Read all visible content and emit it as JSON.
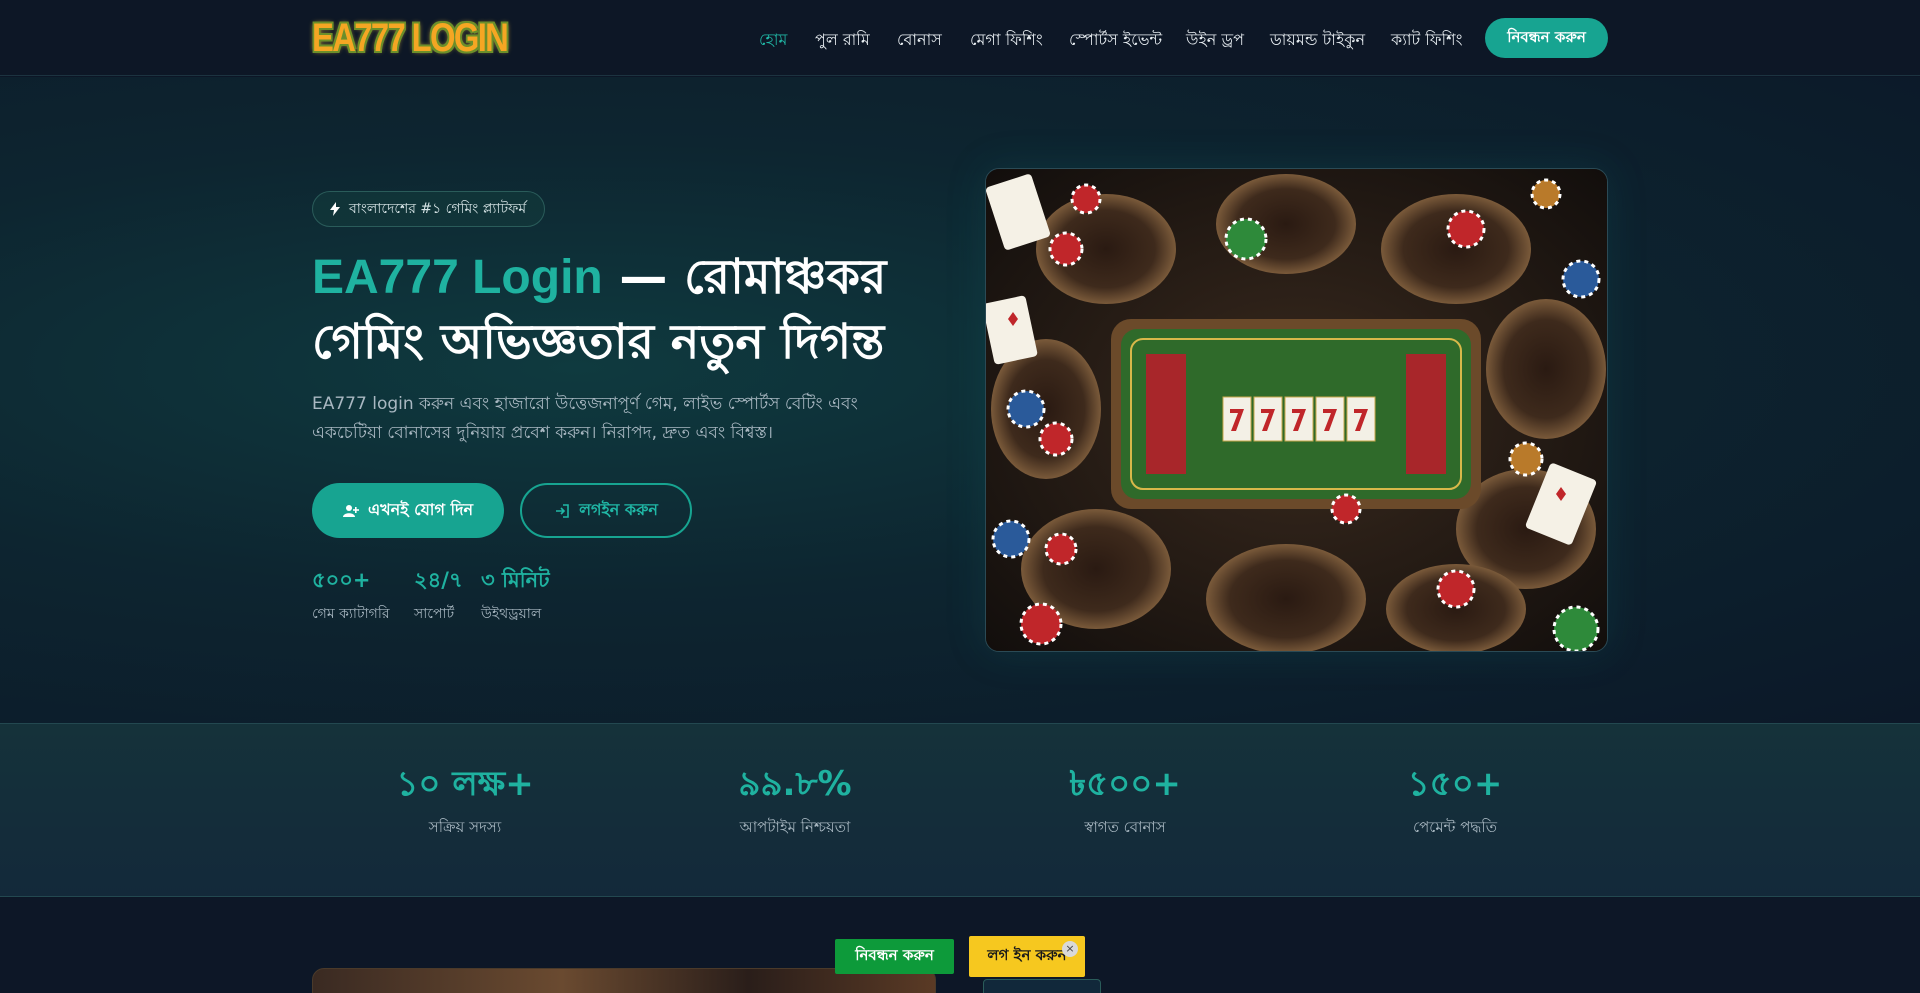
{
  "header": {
    "logo_text": "EA777 LOGIN",
    "nav": [
      {
        "label": "হোম",
        "active": true
      },
      {
        "label": "পুল রামি"
      },
      {
        "label": "বোনাস"
      },
      {
        "label": "মেগা ফিশিং"
      },
      {
        "label": "স্পোর্টস ইভেন্ট"
      },
      {
        "label": "উইন ড্রপ"
      },
      {
        "label": "ডায়মন্ড টাইকুন"
      },
      {
        "label": "ক্যাট ফিশিং"
      }
    ],
    "cta_label": "নিবন্ধন করুন"
  },
  "hero": {
    "badge": "বাংলাদেশের #১ গেমিং প্ল্যাটফর্ম",
    "headline_accent": "EA777 Login",
    "headline_rest_1": " — রোমাঞ্চকর",
    "headline_rest_2": "গেমিং অভিজ্ঞতার নতুন দিগন্ত",
    "subtext": "EA777 login করুন এবং হাজারো উত্তেজনাপূর্ণ গেম, লাইভ স্পোর্টস বেটিং এবং একচেটিয়া বোনাসের দুনিয়ায় প্রবেশ করুন। নিরাপদ, দ্রুত এবং বিশ্বস্ত।",
    "join_label": "এখনই যোগ দিন",
    "login_label": "লগইন করুন",
    "mini_stats": [
      {
        "value": "৫০০+",
        "label": "গেম ক্যাটাগরি"
      },
      {
        "value": "২৪/৭",
        "label": "সাপোর্ট"
      },
      {
        "value": "৩ মিনিট",
        "label": "উইথড্রয়াল"
      }
    ]
  },
  "stats": [
    {
      "value": "১০ লক্ষ+",
      "label": "সক্রিয় সদস্য"
    },
    {
      "value": "৯৯.৮%",
      "label": "আপটাইম নিশ্চয়তা"
    },
    {
      "value": "৳৫০০+",
      "label": "স্বাগত বোনাস"
    },
    {
      "value": "১৫০+",
      "label": "পেমেন্ট পদ্ধতি"
    }
  ],
  "floating": {
    "register_label": "নিবন্ধন করুন",
    "login_label": "লগ ইন করুন",
    "close_icon": "×"
  },
  "colors": {
    "accent": "#17a491",
    "background": "#0c1626",
    "float_register": "#0d9a3a",
    "float_login": "#f6c81f"
  }
}
